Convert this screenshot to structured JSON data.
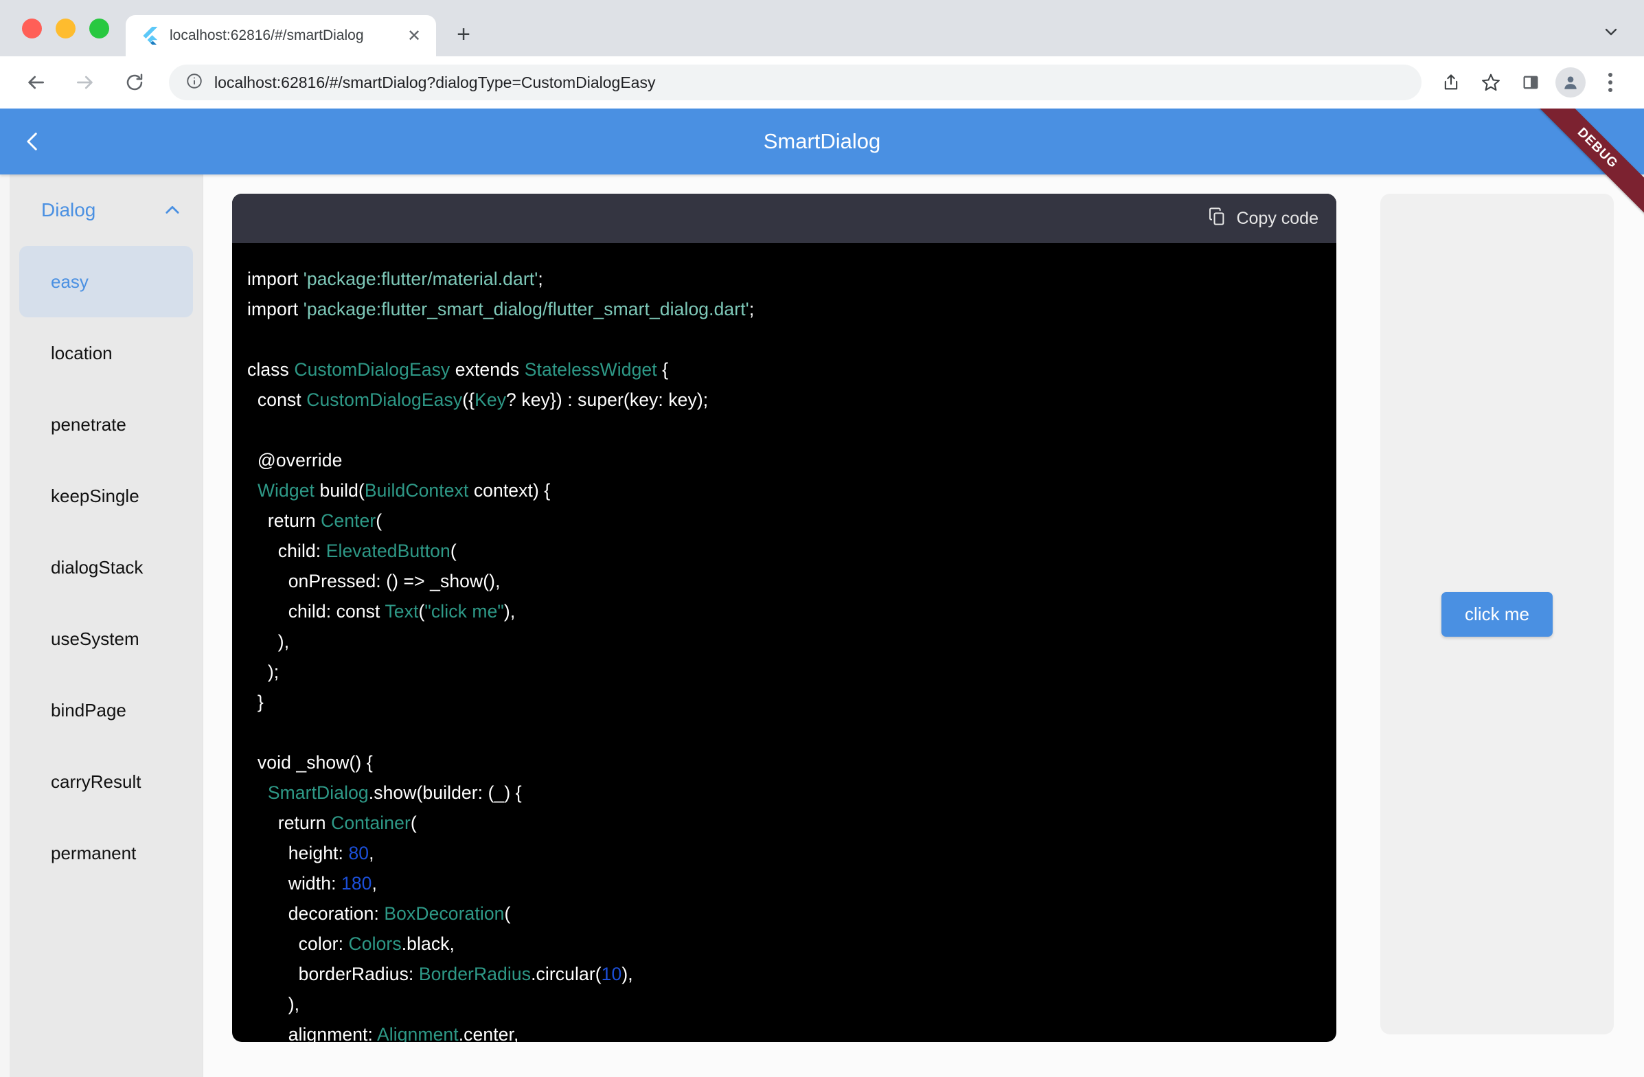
{
  "browser": {
    "tab": {
      "favicon": "flutter-icon",
      "title": "localhost:62816/#/smartDialog",
      "close_label": "✕"
    },
    "new_tab_label": "+",
    "tab_list_chevron": "chevron-down-icon",
    "toolbar": {
      "back_icon": "back-arrow-icon",
      "forward_icon": "forward-arrow-icon",
      "reload_icon": "reload-icon",
      "site_info_icon": "info-circle-icon",
      "url": "localhost:62816/#/smartDialog?dialogType=CustomDialogEasy",
      "url_host": "localhost:62816",
      "url_path": "/#/smartDialog?dialogType=CustomDialogEasy",
      "share_icon": "share-icon",
      "bookmark_icon": "star-icon",
      "side_panel_icon": "side-panel-icon",
      "profile_icon": "profile-avatar-icon",
      "menu_icon": "three-dot-menu-icon"
    }
  },
  "app": {
    "appbar": {
      "back_icon": "chevron-left-icon",
      "title": "SmartDialog",
      "debug_banner": "DEBUG",
      "bg_color": "#4a90e2"
    },
    "sidebar": {
      "group": {
        "label": "Dialog",
        "chevron": "chevron-up-icon",
        "color": "#4a90e2"
      },
      "items": [
        {
          "label": "easy",
          "selected": true
        },
        {
          "label": "location",
          "selected": false
        },
        {
          "label": "penetrate",
          "selected": false
        },
        {
          "label": "keepSingle",
          "selected": false
        },
        {
          "label": "dialogStack",
          "selected": false
        },
        {
          "label": "useSystem",
          "selected": false
        },
        {
          "label": "bindPage",
          "selected": false
        },
        {
          "label": "carryResult",
          "selected": false
        },
        {
          "label": "permanent",
          "selected": false
        }
      ],
      "selected_bg": "#d6dfeb"
    },
    "code_panel": {
      "copy_label": "Copy code",
      "copy_icon": "copy-icon",
      "header_bg": "#343541",
      "body_bg": "#000000",
      "code_text": "import 'package:flutter/material.dart';\nimport 'package:flutter_smart_dialog/flutter_smart_dialog.dart';\n\nclass CustomDialogEasy extends StatelessWidget {\n  const CustomDialogEasy({Key? key}) : super(key: key);\n\n  @override\n  Widget build(BuildContext context) {\n    return Center(\n      child: ElevatedButton(\n        onPressed: () => _show(),\n        child: const Text(\"click me\"),\n      ),\n    );\n  }\n\n  void _show() {\n    SmartDialog.show(builder: (_) {\n      return Container(\n        height: 80,\n        width: 180,\n        decoration: BoxDecoration(\n          color: Colors.black,\n          borderRadius: BorderRadius.circular(10),\n        ),\n        alignment: Alignment.center,"
    },
    "preview": {
      "button_label": "click me",
      "button_color": "#4a90e2",
      "panel_bg": "#f0f0f0"
    }
  }
}
